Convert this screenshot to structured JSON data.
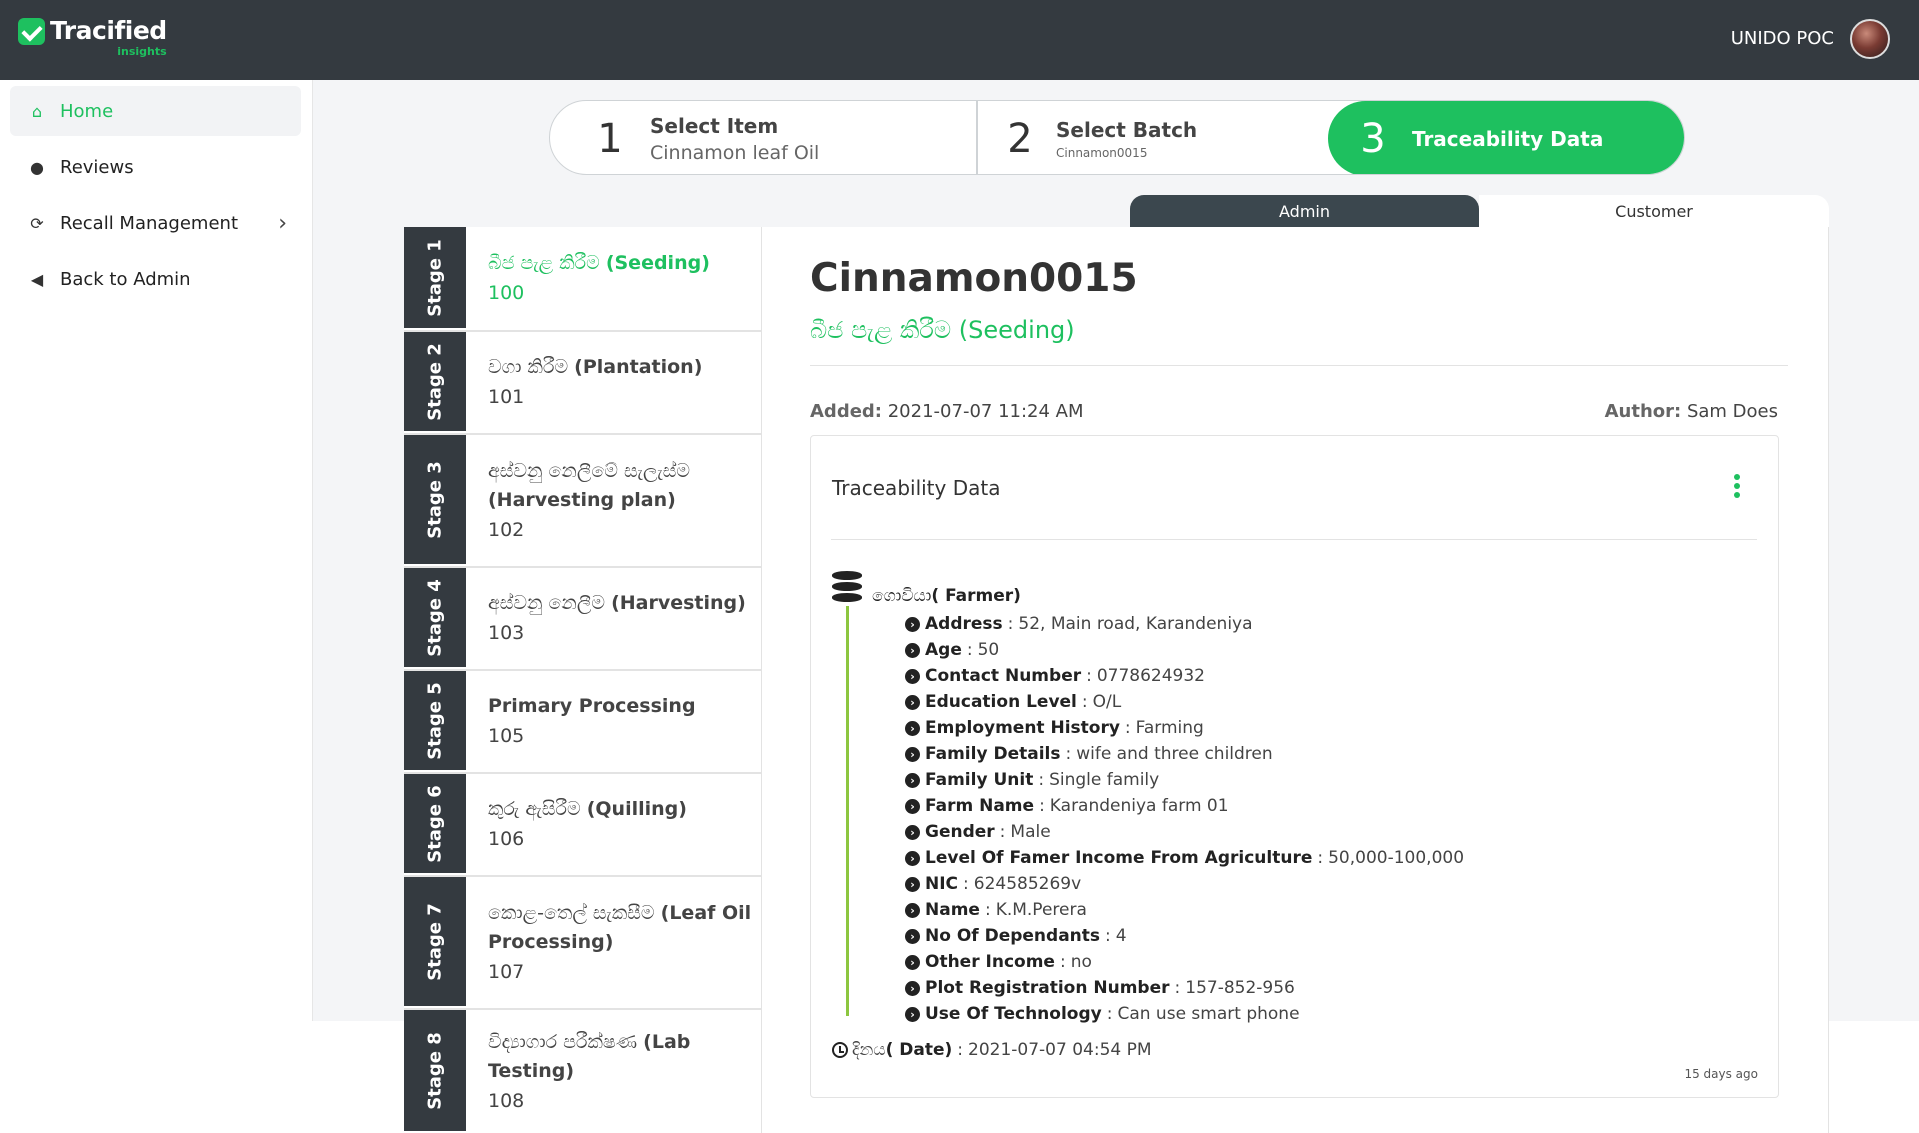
{
  "header": {
    "logo_name": "Tracified",
    "logo_sub": "insights",
    "user_name": "UNIDO POC"
  },
  "sidebar": {
    "items": [
      {
        "label": "Home",
        "icon": "home-icon",
        "active": true
      },
      {
        "label": "Reviews",
        "icon": "comment-icon"
      },
      {
        "label": "Recall Management",
        "icon": "refresh-icon",
        "has_children": true
      },
      {
        "label": "Back to Admin",
        "icon": "arrow-left-circle-icon"
      }
    ]
  },
  "stepper": {
    "steps": [
      {
        "num": "1",
        "title": "Select Item",
        "sub": "Cinnamon leaf Oil"
      },
      {
        "num": "2",
        "title": "Select Batch",
        "sub": "Cinnamon0015"
      },
      {
        "num": "3",
        "title": "Traceability Data"
      }
    ]
  },
  "tabs": {
    "admin": "Admin",
    "customer": "Customer"
  },
  "stages": [
    {
      "tab": "Stage 1",
      "name_si": "බීජ පැළ කිරීම",
      "name_en": "(Seeding)",
      "num": "100"
    },
    {
      "tab": "Stage 2",
      "name_si": "වගා කිරීම",
      "name_en": "(Plantation)",
      "num": "101"
    },
    {
      "tab": "Stage 3",
      "name_si": "අස්වනු නෙලීමේ සැලැස්ම",
      "name_en": "(Harvesting plan)",
      "num": "102"
    },
    {
      "tab": "Stage 4",
      "name_si": "අස්වනු නෙලීම",
      "name_en": "(Harvesting)",
      "num": "103"
    },
    {
      "tab": "Stage 5",
      "name_si": "",
      "name_en": "Primary Processing",
      "num": "105"
    },
    {
      "tab": "Stage 6",
      "name_si": "කුරු ඇසිරීම",
      "name_en": "(Quilling)",
      "num": "106"
    },
    {
      "tab": "Stage 7",
      "name_si": "කොළ-තෙල් සැකසීම",
      "name_en": "(Leaf Oil Processing)",
      "num": "107"
    },
    {
      "tab": "Stage 8",
      "name_si": "විද්‍යාගාර පරීක්ෂණ",
      "name_en": "(Lab Testing)",
      "num": "108"
    }
  ],
  "detail": {
    "title": "Cinnamon0015",
    "subtitle": "බීජ පැළ කිරීම (Seeding)",
    "added_label": "Added:",
    "added_value": "2021-07-07 11:24 AM",
    "author_label": "Author:",
    "author_value": "Sam Does"
  },
  "card": {
    "title": "Traceability Data",
    "group_si": "ගොවියා",
    "group_en": "( Farmer)",
    "fields": [
      {
        "key": "Address",
        "value": "52, Main road, Karandeniya"
      },
      {
        "key": "Age",
        "value": "50"
      },
      {
        "key": "Contact Number",
        "value": "0778624932"
      },
      {
        "key": "Education Level",
        "value": "O/L"
      },
      {
        "key": "Employment History",
        "value": "Farming"
      },
      {
        "key": "Family Details",
        "value": "wife and three children"
      },
      {
        "key": "Family Unit",
        "value": "Single family"
      },
      {
        "key": "Farm Name",
        "value": "Karandeniya farm 01"
      },
      {
        "key": "Gender",
        "value": "Male"
      },
      {
        "key": "Level Of Famer Income From Agriculture",
        "value": "50,000-100,000"
      },
      {
        "key": "NIC",
        "value": "624585269v"
      },
      {
        "key": "Name",
        "value": "K.M.Perera"
      },
      {
        "key": "No Of Dependants",
        "value": "4"
      },
      {
        "key": "Other Income",
        "value": "no"
      },
      {
        "key": "Plot Registration Number",
        "value": "157-852-956"
      },
      {
        "key": "Use Of Technology",
        "value": "Can use smart phone"
      }
    ],
    "date_si": "දිනය",
    "date_en": "( Date)",
    "date_value": "2021-07-07 04:54 PM",
    "ago": "15 days ago"
  },
  "colors": {
    "accent": "#1ec05f",
    "header": "#343a40",
    "timeline": "#8cc63f"
  }
}
